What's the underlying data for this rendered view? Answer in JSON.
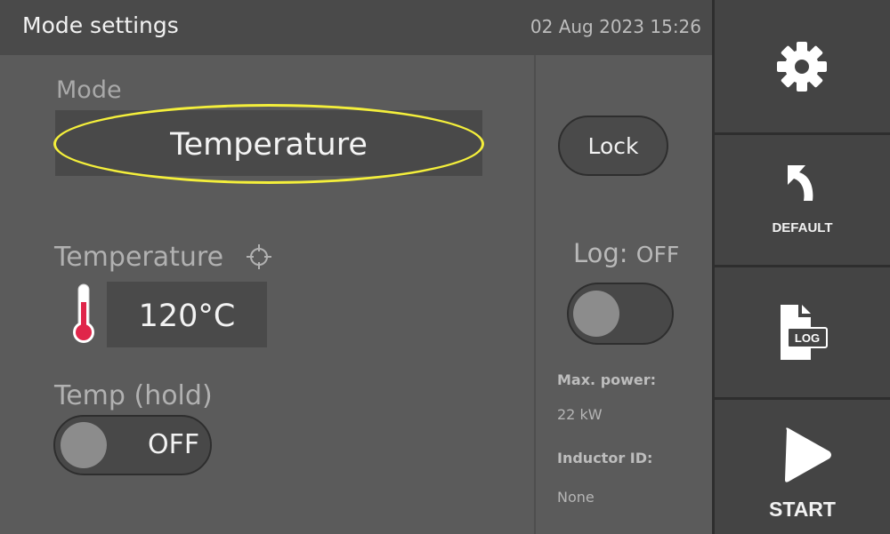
{
  "header": {
    "title": "Mode settings",
    "datetime": "02 Aug 2023 15:26"
  },
  "mode": {
    "label": "Mode",
    "value": "Temperature"
  },
  "temperature": {
    "label": "Temperature",
    "value": "120°C"
  },
  "temp_hold": {
    "label": "Temp (hold)",
    "state": "OFF"
  },
  "lock": {
    "label": "Lock"
  },
  "log": {
    "label": "Log:",
    "state": "OFF"
  },
  "info": {
    "max_power_label": "Max. power:",
    "max_power_value": "22 kW",
    "inductor_label": "Inductor ID:",
    "inductor_value": "None"
  },
  "sidebar": {
    "settings_icon": "gear-icon",
    "default_label": "DEFAULT",
    "log_icon_text": "LOG",
    "start_label": "START"
  },
  "colors": {
    "highlight": "#f4ef3b",
    "thermometer": "#e0264a",
    "sidebar_bg": "#444444",
    "panel_bg": "#5b5b5b"
  }
}
